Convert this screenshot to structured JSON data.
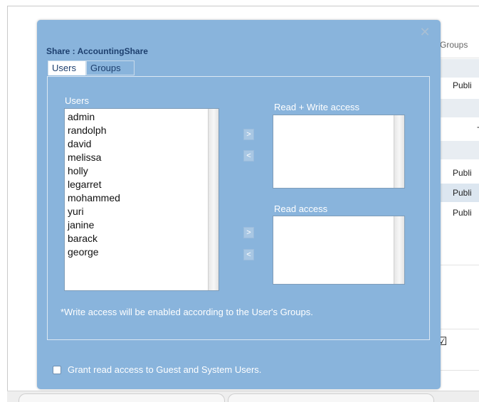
{
  "background": {
    "column_header": "Groups",
    "rows": [
      {
        "text": "",
        "shade": true
      },
      {
        "text": "Publi",
        "shade": false
      },
      {
        "text": "",
        "shade": true
      },
      {
        "text": "-",
        "shade": false
      },
      {
        "text": "",
        "shade": true
      },
      {
        "text": "Publi",
        "shade": false
      },
      {
        "text": "Publi",
        "shade": "hl"
      },
      {
        "text": "Publi",
        "shade": false
      }
    ],
    "checkbox_glyph": "☑"
  },
  "dialog": {
    "close_glyph": "✕",
    "title": "Share : AccountingShare",
    "tabs": [
      {
        "label": "Users",
        "active": true
      },
      {
        "label": "Groups",
        "active": false
      }
    ],
    "users_label": "Users",
    "users": [
      "admin",
      "randolph",
      "david",
      "melissa",
      "holly",
      "legarret",
      "mohammed",
      "yuri",
      "janine",
      "barack",
      "george"
    ],
    "read_write_label": "Read + Write access",
    "read_label": "Read access",
    "add_glyph": ">",
    "remove_glyph": "<",
    "note": "*Write access will be enabled according to the User's Groups.",
    "guest_access_label": "Grant read access to Guest and System Users.",
    "guest_access_checked": false
  },
  "colors": {
    "dialog_bg": "#89b4dc",
    "title": "#1d3f6e",
    "list_border": "#7f9db9"
  }
}
